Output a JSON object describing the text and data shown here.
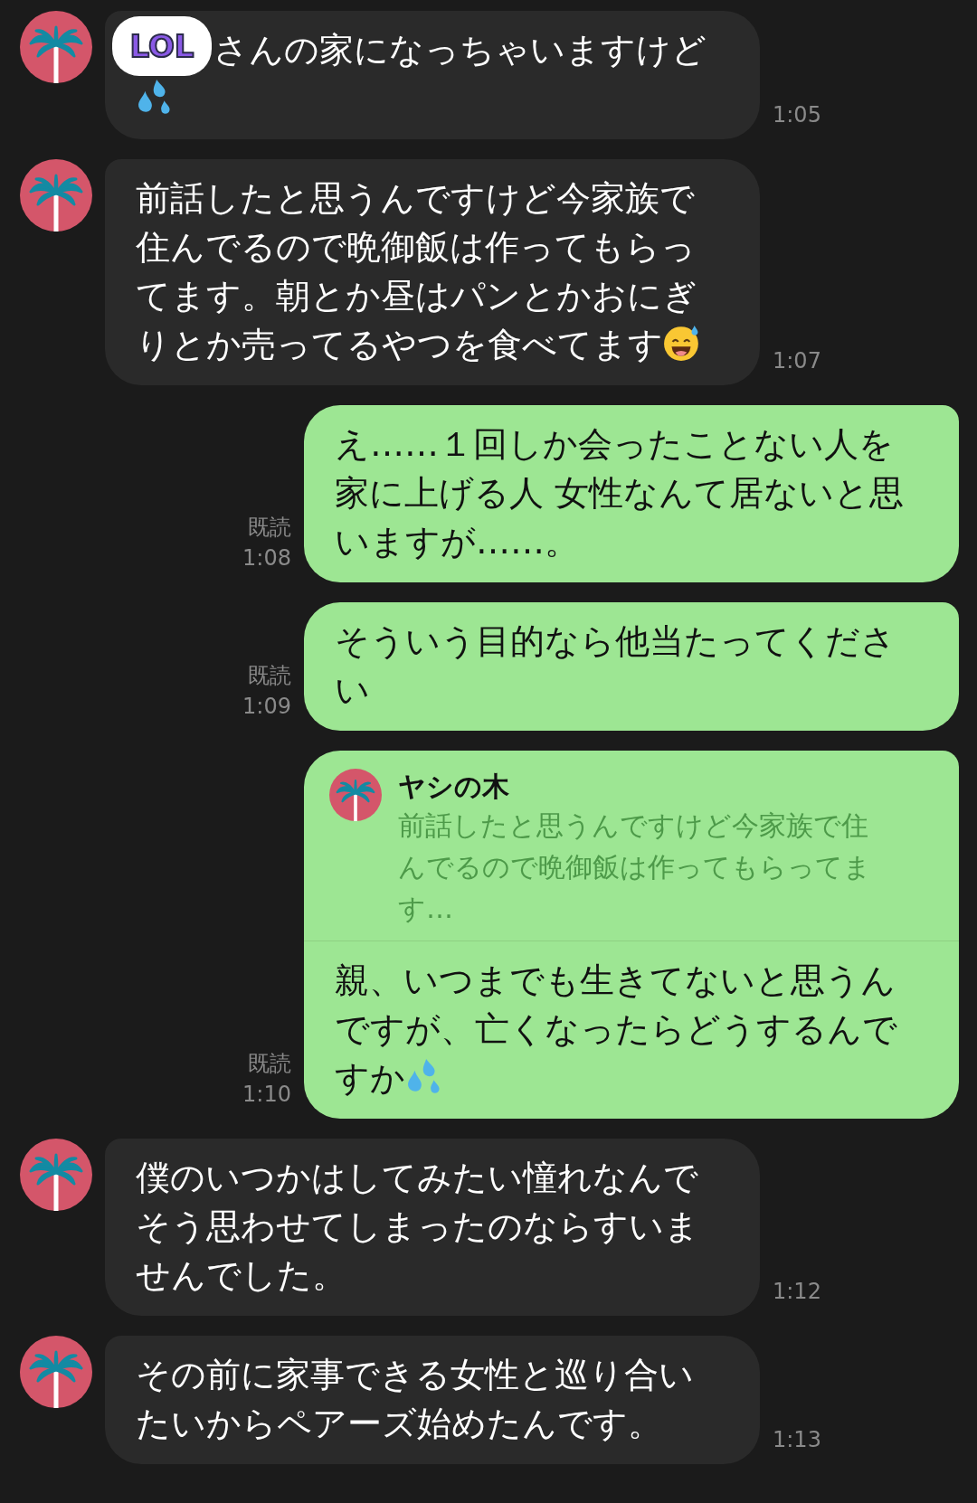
{
  "messages": [
    {
      "kind": "incoming",
      "text": "さんの家になっちゃいますけど",
      "trailing_icon": {
        "kind": "droplets"
      },
      "sticker": "LOL",
      "time": "1:05"
    },
    {
      "kind": "incoming",
      "text": "前話したと思うんですけど今家族で住んでるので晩御飯は作ってもらってます。朝とか昼はパンとかおにぎりとか売ってるやつを食べてます",
      "trailing_icon": {
        "kind": "sweat-smile"
      },
      "time": "1:07"
    },
    {
      "kind": "outgoing",
      "text": "え……１回しか会ったことない人を家に上げる人 女性なんて居ないと思いますが……。",
      "read": "既読",
      "time": "1:08"
    },
    {
      "kind": "outgoing",
      "text": "そういう目的なら他当たってください",
      "read": "既読",
      "time": "1:09"
    },
    {
      "kind": "reply",
      "quote": {
        "name": "ヤシの木",
        "text": "前話したと思うんですけど今家族で住んでるので晩御飯は作ってもらってます…"
      },
      "text": "親、いつまでも生きてないと思うんですが、亡くなったらどうするんですか",
      "trailing_icon": {
        "kind": "droplets"
      },
      "read": "既読",
      "time": "1:10"
    },
    {
      "kind": "incoming",
      "text": "僕のいつかはしてみたい憧れなんでそう思わせてしまったのならすいませんでした。",
      "time": "1:12"
    },
    {
      "kind": "incoming",
      "text": "その前に家事できる女性と巡り合いたいからペアーズ始めたんです。",
      "time": "1:13"
    }
  ]
}
